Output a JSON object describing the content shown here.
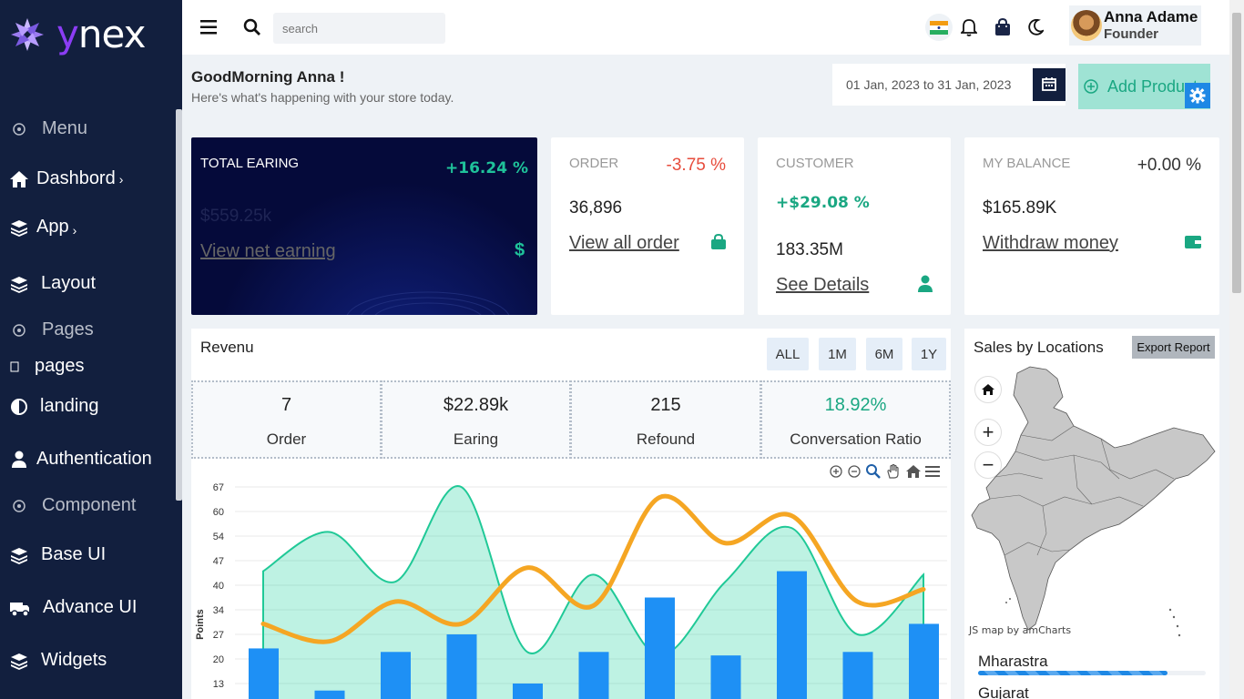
{
  "brand": {
    "logo_text_accent": "y",
    "logo_text_rest": "nex"
  },
  "sidebar": {
    "items": [
      {
        "label": "Menu",
        "type": "header",
        "icon": "circle-dot-icon"
      },
      {
        "label": "Dashbord",
        "type": "item",
        "icon": "home-icon",
        "chevron": "›"
      },
      {
        "label": "App",
        "type": "item",
        "icon": "layers-icon",
        "chevron": "›"
      },
      {
        "label": "Layout",
        "type": "item",
        "icon": "layers-icon"
      },
      {
        "label": "Pages",
        "type": "header",
        "icon": "circle-dot-icon"
      },
      {
        "label": "pages",
        "type": "item",
        "icon": "square-icon"
      },
      {
        "label": "landing",
        "type": "item",
        "icon": "half-circle-icon"
      },
      {
        "label": "Authentication",
        "type": "item",
        "icon": "user-icon"
      },
      {
        "label": "Component",
        "type": "header",
        "icon": "circle-dot-icon"
      },
      {
        "label": "Base UI",
        "type": "item",
        "icon": "layers-icon"
      },
      {
        "label": "Advance UI",
        "type": "item",
        "icon": "truck-icon"
      },
      {
        "label": "Widgets",
        "type": "item",
        "icon": "layers-icon"
      }
    ]
  },
  "topbar": {
    "search_placeholder": "search",
    "icons": [
      "menu-icon",
      "search-icon",
      "india-flag-icon",
      "bell-icon",
      "bag-icon",
      "moon-icon"
    ],
    "user": {
      "name": "Anna Adame",
      "role": "Founder"
    }
  },
  "greeting": {
    "title": "GoodMorning Anna !",
    "subtitle": "Here's what's happening with your store today."
  },
  "date_range": "01 Jan, 2023 to 31 Jan, 2023",
  "add_product_label": "Add Product",
  "cards": {
    "earning": {
      "label": "TOTAL EARING",
      "pct": "+16.24 %",
      "value": "$559.25k",
      "link": "View net earning",
      "icon": "dollar-icon"
    },
    "order": {
      "label": "ORDER",
      "pct": "-3.75 %",
      "value": "36,896",
      "link": "View all order",
      "icon": "bag-icon"
    },
    "customer": {
      "label": "CUSTOMER",
      "pct": "+$29.08 %",
      "value": "183.35M",
      "link": "See Details",
      "icon": "user-icon"
    },
    "balance": {
      "label": "MY BALANCE",
      "pct": "+0.00 %",
      "value": "$165.89K",
      "link": "Withdraw money",
      "icon": "wallet-icon"
    }
  },
  "revenue": {
    "title": "Revenu",
    "ranges": [
      "ALL",
      "1M",
      "6M",
      "1Y"
    ],
    "stats": [
      {
        "value": "7",
        "label": "Order"
      },
      {
        "value": "$22.89k",
        "label": "Earing"
      },
      {
        "value": "215",
        "label": "Refound"
      },
      {
        "value": "18.92%",
        "label": "Conversation Ratio"
      }
    ],
    "toolbar_icons": [
      "zoom-in-icon",
      "zoom-out-icon",
      "magnifier-icon",
      "pan-hand-icon",
      "home-icon",
      "hamburger-menu-icon"
    ]
  },
  "sales": {
    "title": "Sales by Locations",
    "export_label": "Export Report",
    "credit": "JS map by amCharts",
    "map_buttons": [
      "home-icon",
      "zoom-in-icon",
      "zoom-out-icon"
    ],
    "locations": [
      {
        "name": "Mharastra",
        "progress": 0.83
      },
      {
        "name": "Gujarat"
      }
    ]
  },
  "colors": {
    "sidebar": "#121f3e",
    "accent_green": "#1aa782",
    "area": "#34d8a8",
    "line": "#f5a623",
    "bar": "#1e88e5",
    "negative": "#e74c3c"
  },
  "chart_data": {
    "type": "bar",
    "ylabel": "Points",
    "y_ticks": [
      "13",
      "20",
      "27",
      "34",
      "40",
      "47",
      "54",
      "60",
      "67"
    ],
    "series": [
      {
        "type": "bar",
        "values": [
          23,
          11,
          22,
          27,
          13,
          22,
          37,
          21,
          44,
          22,
          30
        ]
      },
      {
        "type": "area",
        "values": [
          44,
          55,
          41,
          67,
          22,
          43,
          21,
          41,
          56,
          27,
          43
        ]
      },
      {
        "type": "line",
        "values": [
          30,
          25,
          36,
          30,
          45,
          35,
          64,
          52,
          59,
          36,
          39
        ]
      }
    ]
  }
}
